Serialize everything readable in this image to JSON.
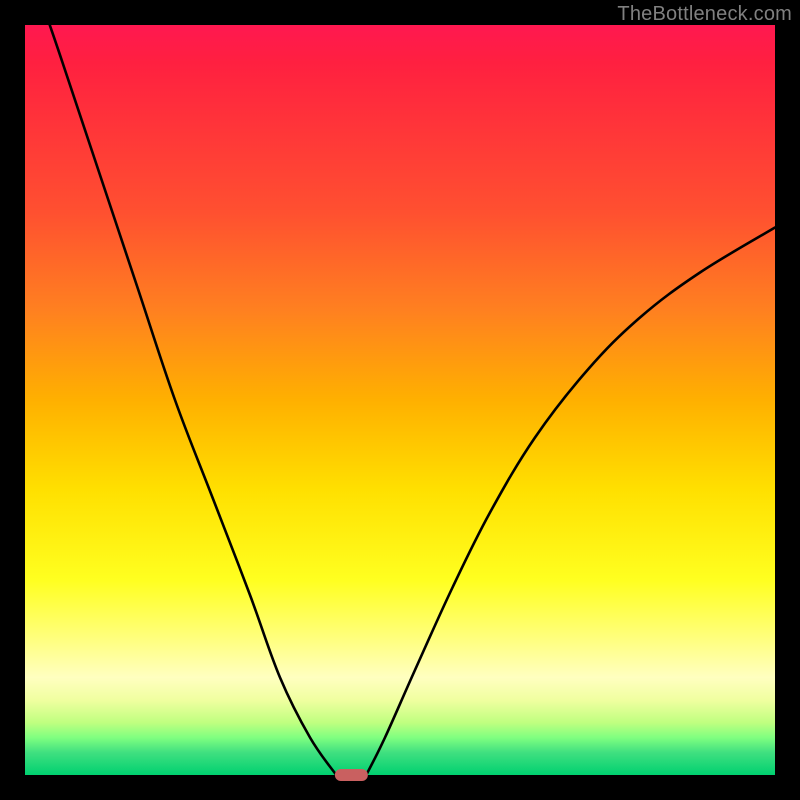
{
  "watermark": "TheBottleneck.com",
  "chart_data": {
    "type": "line",
    "title": "",
    "xlabel": "",
    "ylabel": "",
    "xlim": [
      0,
      100
    ],
    "ylim": [
      0,
      100
    ],
    "gradient_stops": [
      {
        "pos": 0,
        "color": "#ff1850"
      },
      {
        "pos": 25,
        "color": "#ff5030"
      },
      {
        "pos": 50,
        "color": "#ffb000"
      },
      {
        "pos": 74,
        "color": "#ffff20"
      },
      {
        "pos": 90,
        "color": "#c0ff80"
      },
      {
        "pos": 100,
        "color": "#00d070"
      }
    ],
    "series": [
      {
        "name": "left-curve",
        "x": [
          3.3,
          5,
          10,
          15,
          20,
          25,
          30,
          34,
          38,
          41.5
        ],
        "y": [
          100,
          95,
          80,
          65,
          50,
          37,
          24,
          13,
          5,
          0
        ]
      },
      {
        "name": "right-curve",
        "x": [
          45.5,
          48,
          52,
          57,
          62,
          68,
          75,
          82,
          90,
          100
        ],
        "y": [
          0,
          5,
          14,
          25,
          35,
          45,
          54,
          61,
          67,
          73
        ]
      }
    ],
    "marker": {
      "x": 43.5,
      "y": 0,
      "width_pct": 4.3,
      "height_pct": 1.6,
      "color": "#c96060"
    }
  }
}
